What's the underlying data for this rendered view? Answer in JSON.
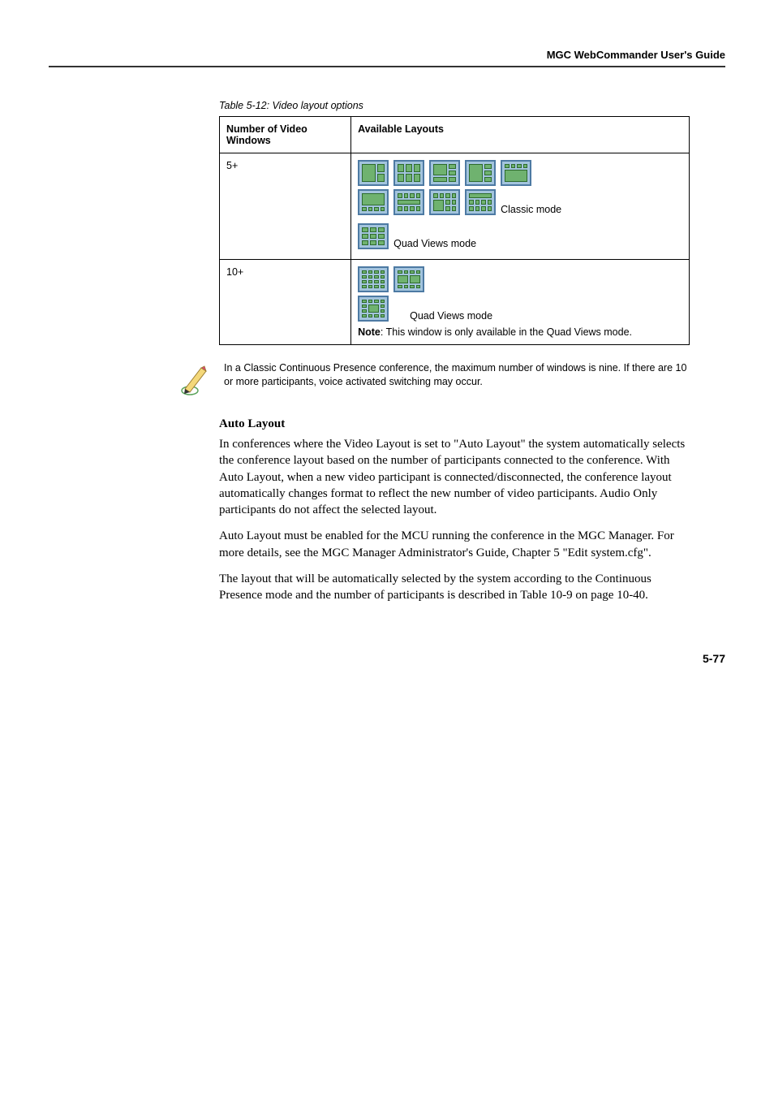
{
  "header": {
    "guide_title": "MGC WebCommander User's Guide"
  },
  "table": {
    "caption": "Table 5-12: Video layout options",
    "headers": {
      "col1": "Number of Video Windows",
      "col2": "Available Layouts"
    },
    "rows": [
      {
        "windows": "5+",
        "classic_label": "Classic mode",
        "quad_label": "Quad Views mode"
      },
      {
        "windows": "10+",
        "quad_label": "Quad Views mode",
        "note_prefix": "Note",
        "note_text": ": This window is only available in the Quad Views mode."
      }
    ]
  },
  "note_box": {
    "text": "In a Classic Continuous Presence conference, the maximum number of windows is nine. If there are 10 or more participants, voice activated switching may occur."
  },
  "section": {
    "heading": "Auto Layout",
    "p1": "In conferences where the Video Layout is set to \"Auto Layout\" the system automatically selects the conference layout based on the number of participants connected to the conference. With Auto Layout, when a new video participant is connected/disconnected, the conference layout automatically changes format to reflect the new number of video participants. Audio Only participants do not affect the selected layout.",
    "p2": "Auto Layout must be enabled for the MCU running the conference in the MGC Manager. For more details, see the MGC Manager Administrator's Guide, Chapter 5 \"Edit system.cfg\".",
    "p3": "The layout that will be automatically selected by the system according to the Continuous Presence mode and the number of participants is described in Table 10-9 on page 10-40."
  },
  "page_number": "5-77"
}
